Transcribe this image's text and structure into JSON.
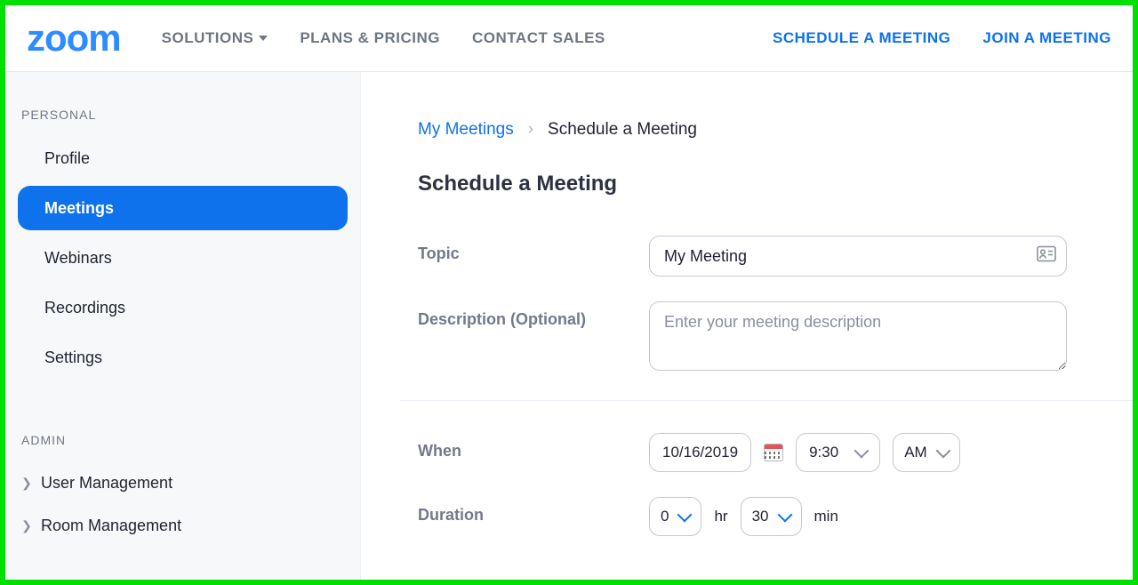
{
  "header": {
    "logo_text": "zoom",
    "nav": {
      "solutions": "SOLUTIONS",
      "plans": "PLANS & PRICING",
      "contact": "CONTACT SALES"
    },
    "links": {
      "schedule": "SCHEDULE A MEETING",
      "join": "JOIN A MEETING"
    }
  },
  "sidebar": {
    "personal_heading": "PERSONAL",
    "items": [
      {
        "label": "Profile",
        "active": false
      },
      {
        "label": "Meetings",
        "active": true
      },
      {
        "label": "Webinars",
        "active": false
      },
      {
        "label": "Recordings",
        "active": false
      },
      {
        "label": "Settings",
        "active": false
      }
    ],
    "admin_heading": "ADMIN",
    "admin_items": [
      {
        "label": "User Management"
      },
      {
        "label": "Room Management"
      }
    ]
  },
  "breadcrumbs": {
    "parent": "My Meetings",
    "current": "Schedule a Meeting"
  },
  "page": {
    "title": "Schedule a Meeting"
  },
  "form": {
    "topic": {
      "label": "Topic",
      "value": "My Meeting"
    },
    "description": {
      "label": "Description (Optional)",
      "placeholder": "Enter your meeting description"
    },
    "when": {
      "label": "When",
      "date": "10/16/2019",
      "time": "9:30",
      "ampm": "AM"
    },
    "duration": {
      "label": "Duration",
      "hours": "0",
      "hours_unit": "hr",
      "minutes": "30",
      "minutes_unit": "min"
    }
  }
}
